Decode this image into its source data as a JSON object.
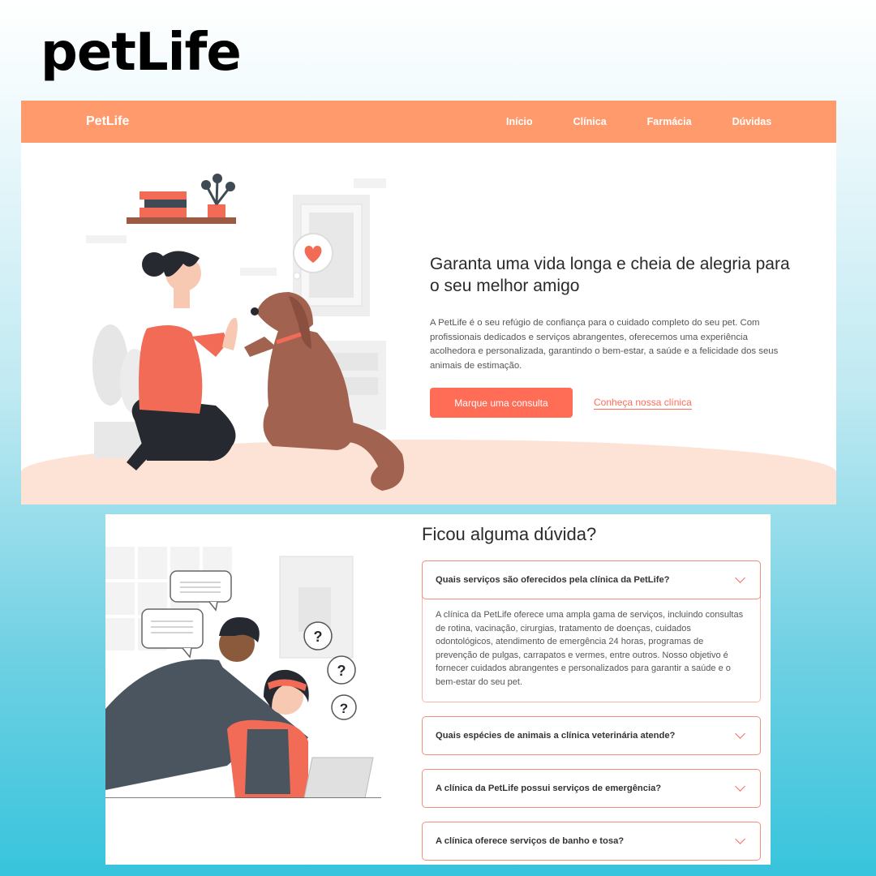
{
  "poster": {
    "title": "petLife"
  },
  "navbar": {
    "brand": "PetLife",
    "links": [
      "Início",
      "Clínica",
      "Farmácia",
      "Dúvidas"
    ]
  },
  "hero": {
    "heading": "Garanta uma vida longa e cheia de alegria para o seu melhor amigo",
    "description": "A PetLife é o seu refúgio de confiança para o cuidado completo do seu pet. Com profissionais dedicados e serviços abrangentes, oferecemos uma experiência acolhedora e personalizada, garantindo o bem-estar, a saúde e a felicidade dos seus animais de estimação.",
    "cta_primary": "Marque uma consulta",
    "cta_secondary": "Conheça nossa clínica"
  },
  "faq": {
    "title": "Ficou alguma dúvida?",
    "items": [
      {
        "question": "Quais serviços são oferecidos pela clínica da PetLife?",
        "answer": "A clínica da PetLife oferece uma ampla gama de serviços, incluindo consultas de rotina, vacinação, cirurgias, tratamento de doenças, cuidados odontológicos, atendimento de emergência 24 horas, programas de prevenção de pulgas, carrapatos e vermes, entre outros. Nosso objetivo é fornecer cuidados abrangentes e personalizados para garantir a saúde e o bem-estar do seu pet."
      },
      {
        "question": "Quais espécies de animais a clínica veterinária atende?"
      },
      {
        "question": "A clínica da PetLife possui serviços de emergência?"
      },
      {
        "question": "A clínica oferece serviços de banho e tosa?"
      }
    ]
  },
  "colors": {
    "navbar": "#ff9a6c",
    "accent": "#ff6d57",
    "floor": "#fde3d6",
    "dog": "#a1624f",
    "shirt": "#f26b56"
  }
}
